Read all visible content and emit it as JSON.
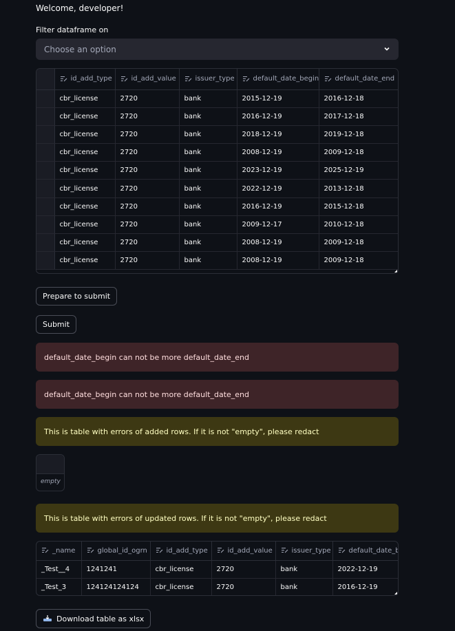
{
  "header": {
    "welcome": "Welcome, developer!"
  },
  "filter": {
    "label": "Filter dataframe on",
    "placeholder": "Choose an option"
  },
  "main_table": {
    "columns": [
      "id_add_type",
      "id_add_value",
      "issuer_type",
      "default_date_begin",
      "default_date_end"
    ],
    "rows": [
      [
        "cbr_license",
        "2720",
        "bank",
        "2015-12-19",
        "2016-12-18"
      ],
      [
        "cbr_license",
        "2720",
        "bank",
        "2016-12-19",
        "2017-12-18"
      ],
      [
        "cbr_license",
        "2720",
        "bank",
        "2018-12-19",
        "2019-12-18"
      ],
      [
        "cbr_license",
        "2720",
        "bank",
        "2008-12-19",
        "2009-12-18"
      ],
      [
        "cbr_license",
        "2720",
        "bank",
        "2023-12-19",
        "2025-12-19"
      ],
      [
        "cbr_license",
        "2720",
        "bank",
        "2022-12-19",
        "2013-12-18"
      ],
      [
        "cbr_license",
        "2720",
        "bank",
        "2016-12-19",
        "2015-12-18"
      ],
      [
        "cbr_license",
        "2720",
        "bank",
        "2009-12-17",
        "2010-12-18"
      ],
      [
        "cbr_license",
        "2720",
        "bank",
        "2008-12-19",
        "2009-12-18"
      ],
      [
        "cbr_license",
        "2720",
        "bank",
        "2008-12-19",
        "2009-12-18"
      ]
    ]
  },
  "buttons": {
    "prepare": "Prepare to submit",
    "submit": "Submit",
    "download": "Download table as xlsx"
  },
  "alerts": {
    "error1": "default_date_begin can not be more default_date_end",
    "error2": "default_date_begin can not be more default_date_end",
    "added_warning": "This is table with errors of added rows. If it is not \"empty\", please redact",
    "updated_warning": "This is table with errors of updated rows. If it is not \"empty\", please redact"
  },
  "added_errors": {
    "value": "empty"
  },
  "updated_table": {
    "columns": [
      "_name",
      "global_id_ogrn",
      "id_add_type",
      "id_add_value",
      "issuer_type",
      "default_date_be"
    ],
    "rows": [
      [
        "_Test__4",
        "1241241",
        "cbr_license",
        "2720",
        "bank",
        "2022-12-19"
      ],
      [
        "_Test_3",
        "124124124124",
        "cbr_license",
        "2720",
        "bank",
        "2016-12-19"
      ]
    ]
  },
  "icons": {
    "column": "edit-column-icon",
    "select": "chevron-down-icon",
    "download": "download-icon"
  }
}
